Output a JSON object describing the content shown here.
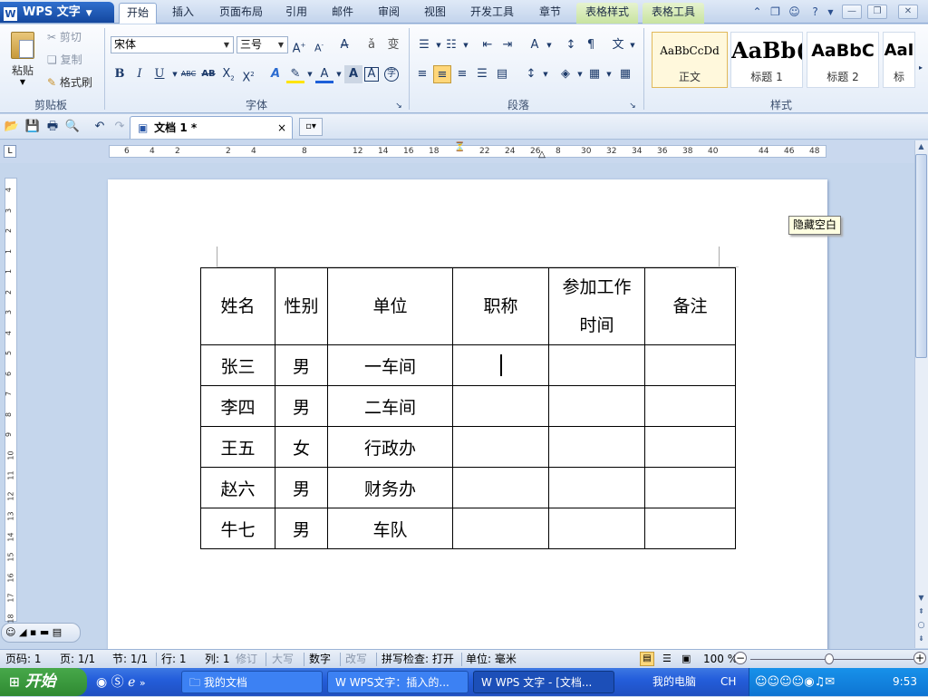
{
  "app": {
    "menu_label": "WPS 文字"
  },
  "tabs": [
    {
      "label": "开始",
      "active": true
    },
    {
      "label": "插入"
    },
    {
      "label": "页面布局"
    },
    {
      "label": "引用"
    },
    {
      "label": "邮件"
    },
    {
      "label": "审阅"
    },
    {
      "label": "视图"
    },
    {
      "label": "开发工具"
    },
    {
      "label": "章节"
    },
    {
      "label": "表格样式",
      "contextual": true
    },
    {
      "label": "表格工具",
      "contextual": true
    }
  ],
  "ribbon": {
    "clipboard": {
      "paste": "粘贴",
      "cut": "剪切",
      "copy": "复制",
      "format_painter": "格式刷",
      "group_label": "剪贴板"
    },
    "font": {
      "font_name": "宋体",
      "font_size": "三号",
      "group_label": "字体"
    },
    "paragraph": {
      "group_label": "段落"
    },
    "styles": {
      "group_label": "样式",
      "items": [
        {
          "preview": "AaBbCcDd",
          "name": "正文"
        },
        {
          "preview": "AaBb(",
          "name": "标题 1"
        },
        {
          "preview": "AaBbC",
          "name": "标题 2"
        },
        {
          "preview": "AaI",
          "name": "标"
        }
      ]
    }
  },
  "document_tab": {
    "title": "文档 1 *",
    "close": "×"
  },
  "ruler": {
    "horizontal": [
      "6",
      "4",
      "2",
      "2",
      "4",
      "8",
      "12",
      "14",
      "16",
      "18",
      "22",
      "24",
      "26",
      "8",
      "30",
      "32",
      "34",
      "36",
      "38",
      "40",
      "44",
      "46",
      "48"
    ],
    "vertical": [
      "4",
      "3",
      "2",
      "1",
      "1",
      "2",
      "3",
      "4",
      "5",
      "6",
      "7",
      "8",
      "9",
      "10",
      "11",
      "12",
      "13",
      "14",
      "15",
      "16",
      "17",
      "18"
    ]
  },
  "tooltip": "隐藏空白",
  "table": {
    "headers": [
      "姓名",
      "性别",
      "单位",
      "职称",
      "参加工作时间",
      "备注"
    ],
    "rows": [
      [
        "张三",
        "男",
        "一车间",
        "",
        "",
        ""
      ],
      [
        "李四",
        "男",
        "二车间",
        "",
        "",
        ""
      ],
      [
        "王五",
        "女",
        "行政办",
        "",
        "",
        ""
      ],
      [
        "赵六",
        "男",
        "财务办",
        "",
        "",
        ""
      ],
      [
        "牛七",
        "男",
        "车队",
        "",
        "",
        ""
      ]
    ]
  },
  "status": {
    "page_num": "页码: 1",
    "page": "页: 1/1",
    "section": "节: 1/1",
    "line": "行: 1",
    "col": "列: 1",
    "rev": "修订",
    "caps": "大写",
    "num": "数字",
    "ovr": "改写",
    "spell": "拼写检查: 打开",
    "unit": "单位: 毫米",
    "zoom": "100 %"
  },
  "taskbar": {
    "start": "开始",
    "tasks": [
      "我的文档",
      "WPS文字：插入的...",
      "WPS 文字 - [文档..."
    ],
    "my_computer": "我的电脑",
    "lang": "CH",
    "clock": "9:53"
  }
}
